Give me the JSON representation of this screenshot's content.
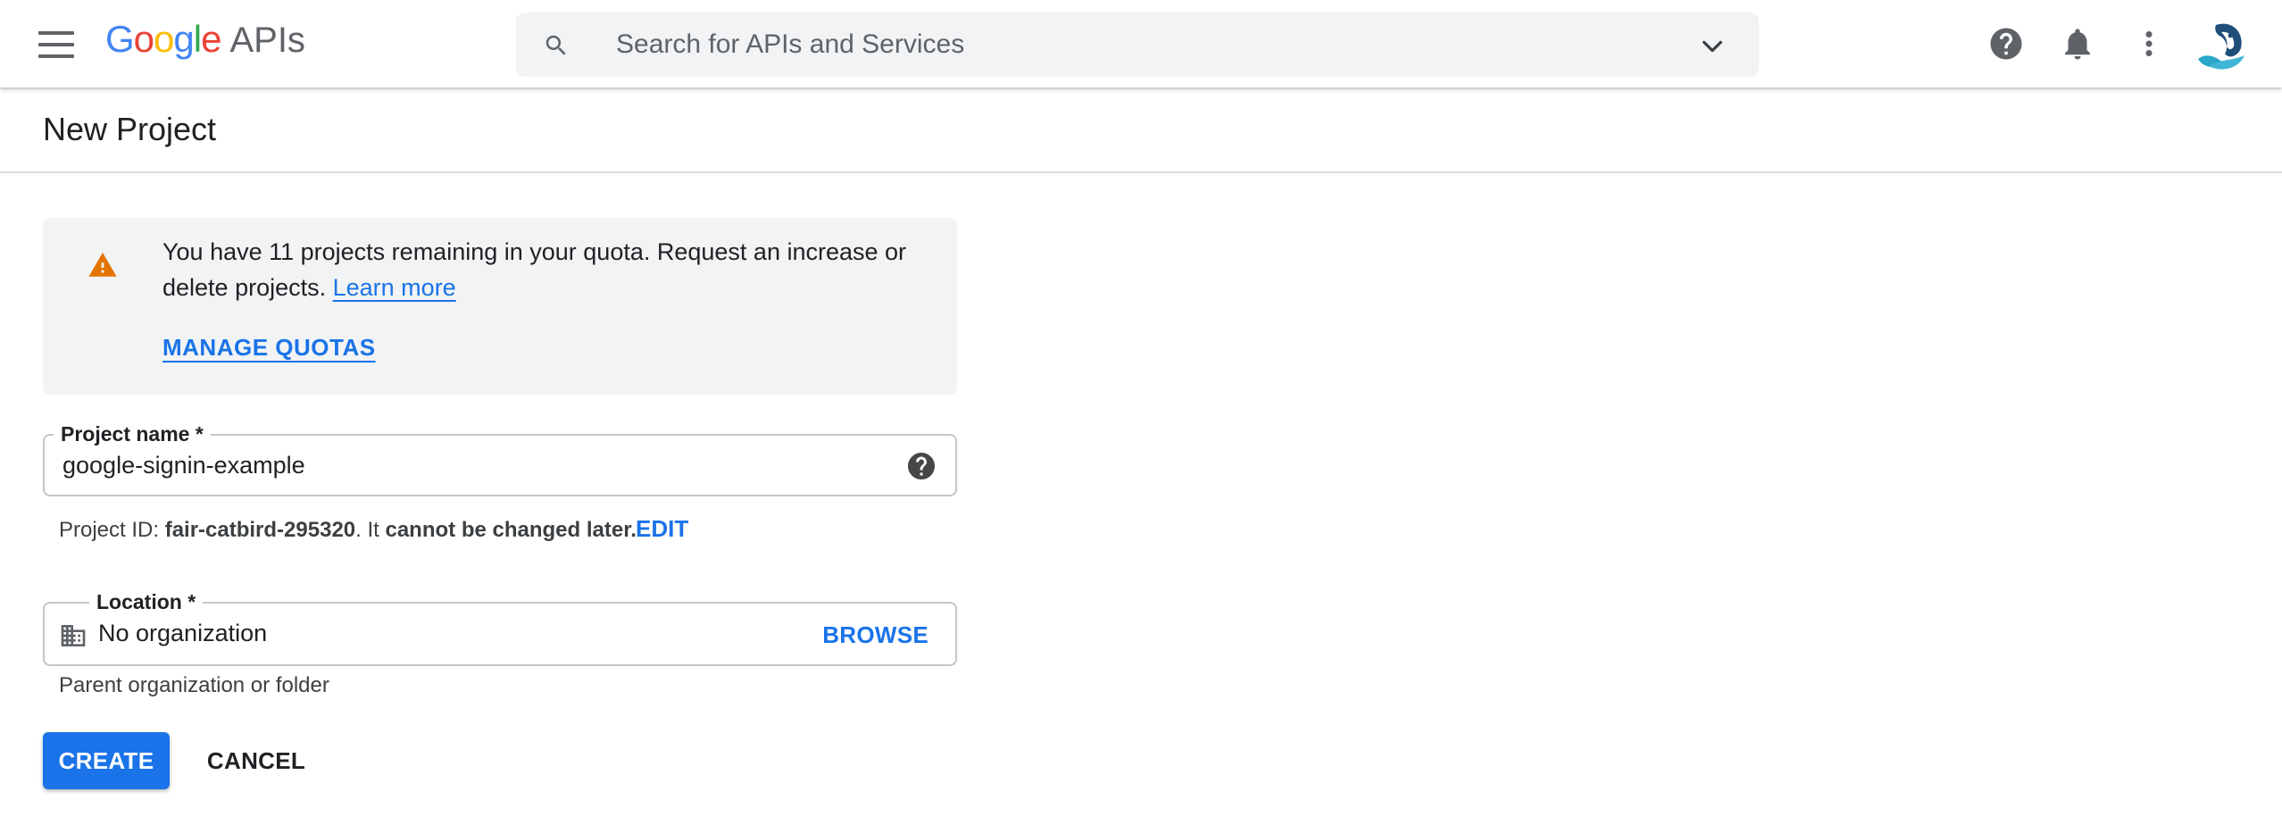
{
  "header": {
    "logo_letters": [
      "G",
      "o",
      "o",
      "g",
      "l",
      "e"
    ],
    "logo_suffix": "APIs",
    "search_placeholder": "Search for APIs and Services"
  },
  "page": {
    "title": "New Project"
  },
  "banner": {
    "message": "You have 11 projects remaining in your quota. Request an increase or delete projects.",
    "learn_more": "Learn more",
    "manage_quotas": "MANAGE QUOTAS"
  },
  "project_name": {
    "label": "Project name *",
    "value": "google-signin-example"
  },
  "project_id": {
    "prefix": "Project ID:",
    "id": "fair-catbird-295320",
    "middle": ". It",
    "suffix": "cannot be changed later.",
    "edit": "EDIT"
  },
  "location": {
    "label": "Location *",
    "value": "No organization",
    "browse": "BROWSE",
    "helper": "Parent organization or folder"
  },
  "actions": {
    "create": "CREATE",
    "cancel": "CANCEL"
  },
  "icons": {
    "menu": "hamburger-menu-icon",
    "search": "search-icon",
    "dropdown": "chevron-down-icon",
    "help": "help-circle-icon",
    "notifications": "bell-icon",
    "more": "more-vert-icon",
    "warning": "warning-icon",
    "building": "building-icon"
  },
  "colors": {
    "accent": "#1a73e8",
    "warning": "#e37400",
    "banner_bg": "#f1f3f4"
  }
}
